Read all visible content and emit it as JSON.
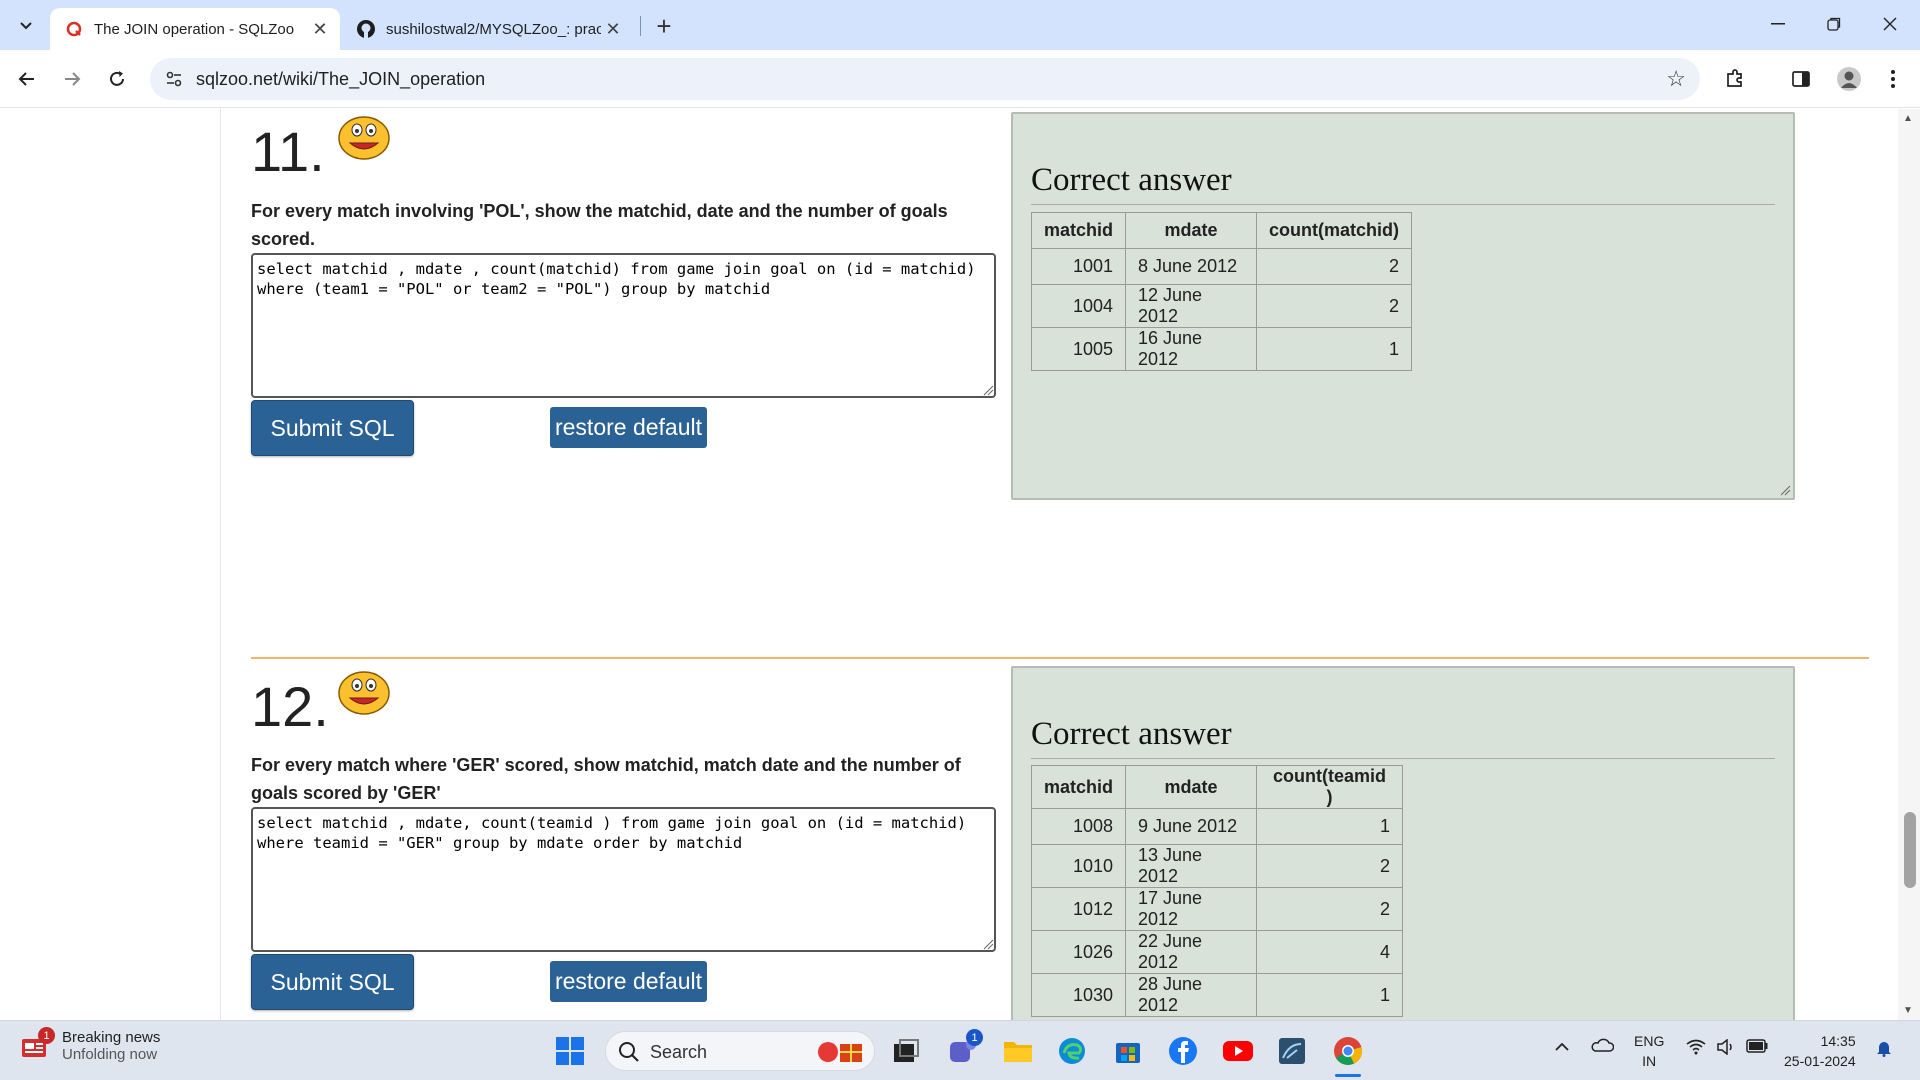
{
  "browser": {
    "tabs": [
      {
        "title": "The JOIN operation - SQLZoo",
        "active": true
      },
      {
        "title": "sushilostwal2/MYSQLZoo_: prac",
        "active": false
      }
    ],
    "url": "sqlzoo.net/wiki/The_JOIN_operation"
  },
  "questions": [
    {
      "number": "11.",
      "text": "For every match involving 'POL', show the matchid, date and the number of goals scored.",
      "sql": "select matchid , mdate , count(matchid) from game join goal on (id = matchid)\nwhere (team1 = \"POL\" or team2 = \"POL\") group by matchid",
      "submit_label": "Submit SQL",
      "restore_label": "restore default",
      "answer_title": "Correct answer",
      "columns": [
        "matchid",
        "mdate",
        "count(matchid)"
      ],
      "rows": [
        [
          "1001",
          "8 June 2012",
          "2"
        ],
        [
          "1004",
          "12 June 2012",
          "2"
        ],
        [
          "1005",
          "16 June 2012",
          "1"
        ]
      ]
    },
    {
      "number": "12.",
      "text": "For every match where 'GER' scored, show matchid, match date and the number of goals scored by 'GER'",
      "sql": "select matchid , mdate, count(teamid ) from game join goal on (id = matchid)\nwhere teamid = \"GER\" group by mdate order by matchid",
      "submit_label": "Submit SQL",
      "restore_label": "restore default",
      "answer_title": "Correct answer",
      "columns": [
        "matchid",
        "mdate",
        "count(teamid )"
      ],
      "rows": [
        [
          "1008",
          "9 June 2012",
          "1"
        ],
        [
          "1010",
          "13 June 2012",
          "2"
        ],
        [
          "1012",
          "17 June 2012",
          "2"
        ],
        [
          "1026",
          "22 June 2012",
          "4"
        ],
        [
          "1030",
          "28 June 2012",
          "1"
        ]
      ]
    }
  ],
  "taskbar": {
    "news_title": "Breaking news",
    "news_subtitle": "Unfolding now",
    "news_badge": "1",
    "search_label": "Search",
    "teams_badge": "1",
    "lang_line1": "ENG",
    "lang_line2": "IN",
    "time": "14:35",
    "date": "25-01-2024"
  },
  "colors": {
    "button_blue": "#2b6296",
    "answer_bg": "#d8e2d9",
    "divider_orange": "#f4b36a",
    "tabstrip": "#d3e3fd"
  },
  "icons": [
    "tab-search-icon",
    "sqlzoo-favicon",
    "github-favicon",
    "close-icon",
    "new-tab-icon",
    "minimize-icon",
    "restore-icon",
    "window-close-icon",
    "back-icon",
    "forward-icon",
    "reload-icon",
    "site-info-icon",
    "bookmark-star-icon",
    "extensions-icon",
    "side-panel-icon",
    "profile-avatar",
    "menu-dots-icon",
    "smiley-icon",
    "windows-start-icon",
    "search-icon",
    "task-view-icon",
    "teams-icon",
    "file-explorer-icon",
    "edge-icon",
    "store-icon",
    "facebook-icon",
    "youtube-icon",
    "app-icon",
    "chrome-icon",
    "chevron-up-icon",
    "onedrive-icon",
    "wifi-icon",
    "volume-icon",
    "battery-icon",
    "notification-bell-icon"
  ]
}
